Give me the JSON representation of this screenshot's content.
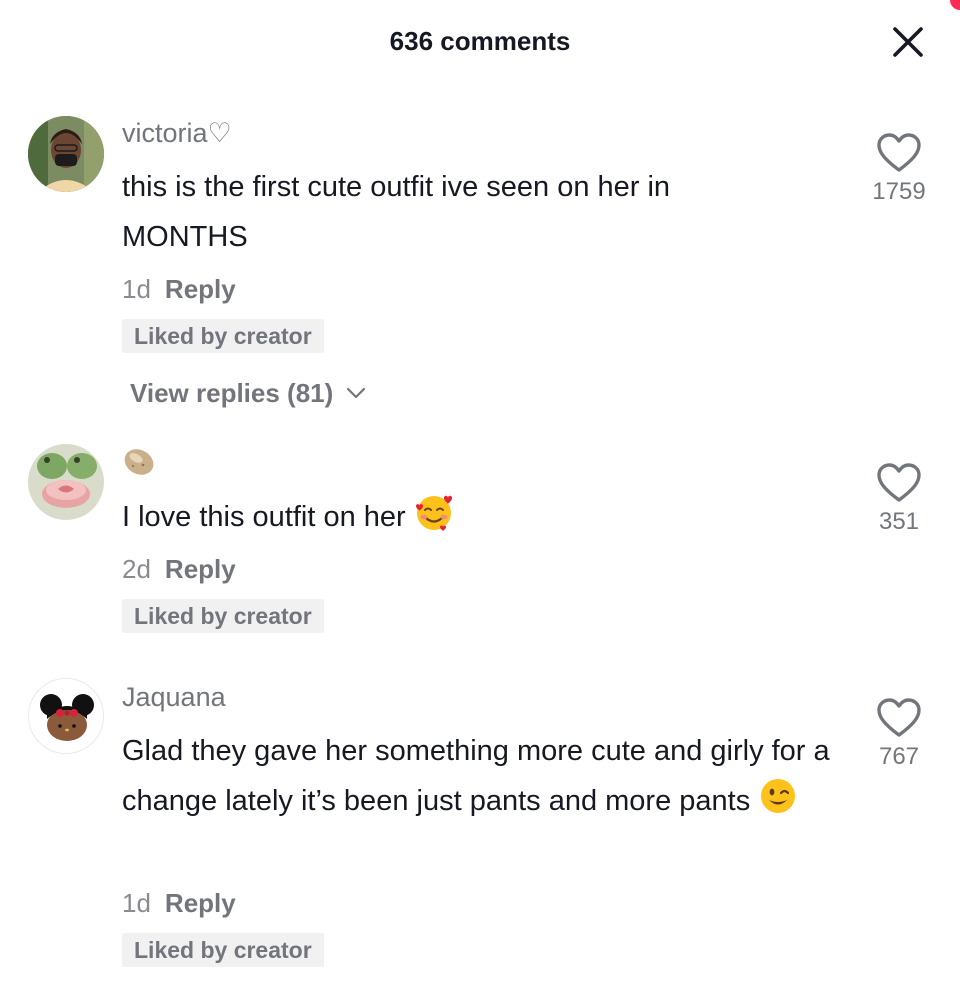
{
  "header": {
    "title": "636 comments"
  },
  "comments": [
    {
      "author": "victoria♡",
      "text": "this is the first cute outfit ive seen on her in MONTHS",
      "age": "1d",
      "reply_label": "Reply",
      "badge": "Liked by creator",
      "likes": "1759",
      "view_replies": "View replies (81)"
    },
    {
      "author": "",
      "text": "I love this outfit on her",
      "emoji": "smiling-face-with-hearts",
      "age": "2d",
      "reply_label": "Reply",
      "badge": "Liked by creator",
      "likes": "351"
    },
    {
      "author": "Jaquana",
      "text": "Glad they gave her something more cute and girly for a change lately it’s been just pants and more pants",
      "emoji": "winking-face",
      "age": "1d",
      "reply_label": "Reply",
      "badge": "Liked by creator",
      "likes": "767"
    }
  ]
}
